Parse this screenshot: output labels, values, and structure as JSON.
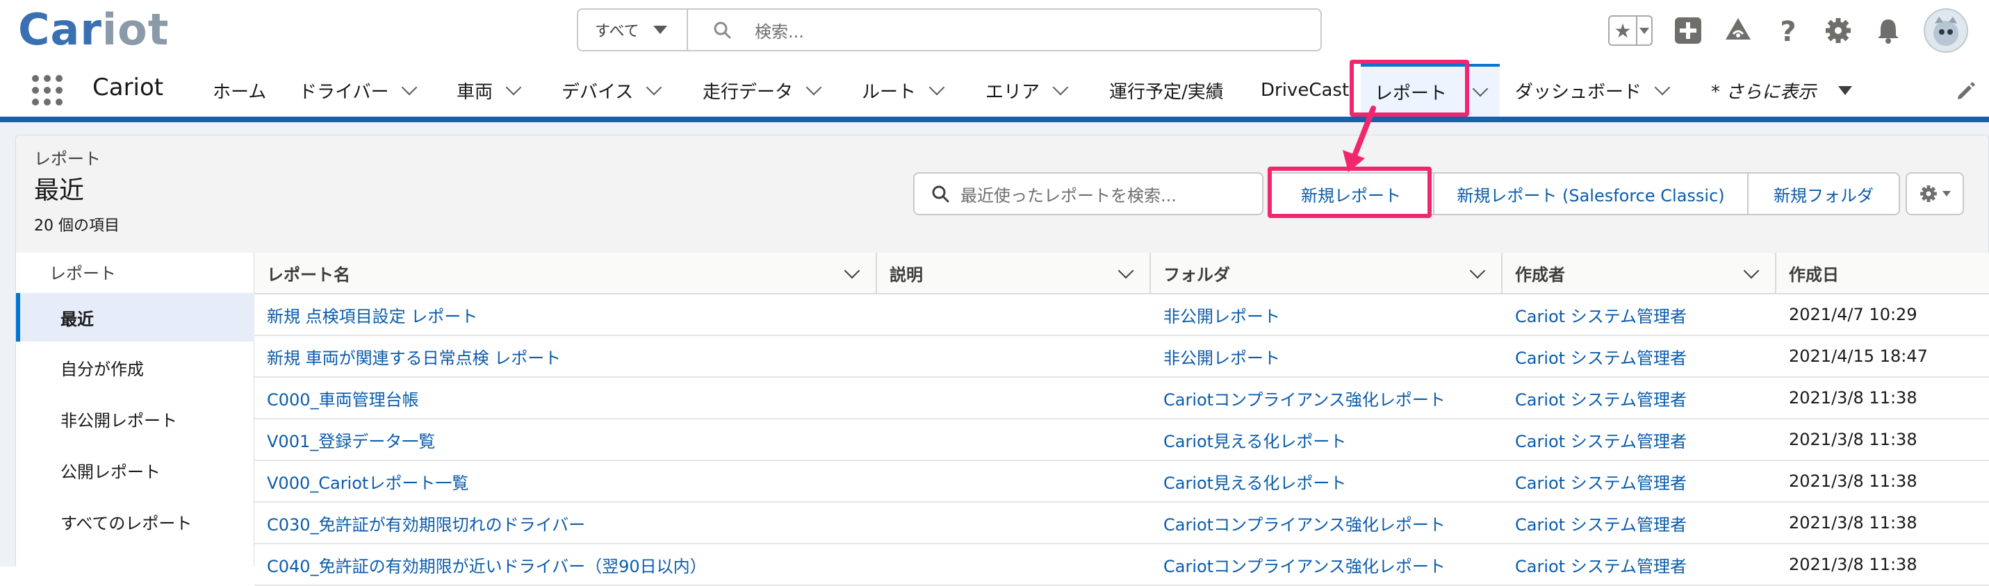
{
  "header": {
    "logo_part1": "Car",
    "logo_part2": "iot",
    "search_scope": "すべて",
    "search_placeholder": "検索..."
  },
  "nav": {
    "app_name": "Cariot",
    "items": [
      {
        "label": "ホーム",
        "has_chevron": false
      },
      {
        "label": "ドライバー",
        "has_chevron": true
      },
      {
        "label": "車両",
        "has_chevron": true
      },
      {
        "label": "デバイス",
        "has_chevron": true
      },
      {
        "label": "走行データ",
        "has_chevron": true
      },
      {
        "label": "ルート",
        "has_chevron": true
      },
      {
        "label": "エリア",
        "has_chevron": true
      },
      {
        "label": "運行予定/実績",
        "has_chevron": false
      },
      {
        "label": "DriveCast",
        "has_chevron": false
      },
      {
        "label": "レポート",
        "has_chevron": true,
        "active": true
      },
      {
        "label": "ダッシュボード",
        "has_chevron": true
      }
    ],
    "more_label": "* さらに表示"
  },
  "page_header": {
    "breadcrumb": "レポート",
    "title": "最近",
    "item_count": "20 個の項目",
    "search_placeholder": "最近使ったレポートを検索...",
    "buttons": {
      "new_report": "新規レポート",
      "new_report_classic": "新規レポート (Salesforce Classic)",
      "new_folder": "新規フォルダ"
    }
  },
  "sidebar": {
    "heading": "レポート",
    "items": [
      {
        "label": "最近",
        "active": true
      },
      {
        "label": "自分が作成"
      },
      {
        "label": "非公開レポート"
      },
      {
        "label": "公開レポート"
      },
      {
        "label": "すべてのレポート"
      }
    ]
  },
  "table": {
    "columns": [
      "レポート名",
      "説明",
      "フォルダ",
      "作成者",
      "作成日"
    ],
    "rows": [
      {
        "name": "新規 点検項目設定 レポート",
        "description": "",
        "folder": "非公開レポート",
        "created_by": "Cariot システム管理者",
        "created_date": "2021/4/7 10:29"
      },
      {
        "name": "新規 車両が関連する日常点検 レポート",
        "description": "",
        "folder": "非公開レポート",
        "created_by": "Cariot システム管理者",
        "created_date": "2021/4/15 18:47"
      },
      {
        "name": "C000_車両管理台帳",
        "description": "",
        "folder": "Cariotコンプライアンス強化レポート",
        "created_by": "Cariot システム管理者",
        "created_date": "2021/3/8 11:38"
      },
      {
        "name": "V001_登録データ一覧",
        "description": "",
        "folder": "Cariot見える化レポート",
        "created_by": "Cariot システム管理者",
        "created_date": "2021/3/8 11:38"
      },
      {
        "name": "V000_Cariotレポート一覧",
        "description": "",
        "folder": "Cariot見える化レポート",
        "created_by": "Cariot システム管理者",
        "created_date": "2021/3/8 11:38"
      },
      {
        "name": "C030_免許証が有効期限切れのドライバー",
        "description": "",
        "folder": "Cariotコンプライアンス強化レポート",
        "created_by": "Cariot システム管理者",
        "created_date": "2021/3/8 11:38"
      },
      {
        "name": "C040_免許証の有効期限が近いドライバー（翌90日以内）",
        "description": "",
        "folder": "Cariotコンプライアンス強化レポート",
        "created_by": "Cariot システム管理者",
        "created_date": "2021/3/8 11:38"
      }
    ]
  },
  "colors": {
    "brand_blue": "#0176d3",
    "link_blue": "#0b5cab",
    "highlight_pink": "#f0266e",
    "nav_stripe": "#1b5fa8"
  },
  "icons": [
    "search-icon",
    "star-icon",
    "add-icon",
    "trailhead-icon",
    "help-icon",
    "setup-gear-icon",
    "bell-icon",
    "avatar",
    "app-launcher-icon",
    "edit-pencil-icon",
    "settings-gear-icon"
  ]
}
